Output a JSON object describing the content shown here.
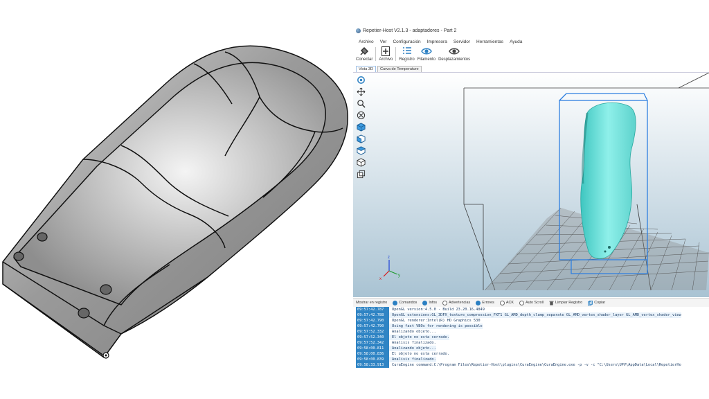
{
  "window": {
    "title": "Repetier-Host V2.1.3 - adaptadores - Part 2"
  },
  "menu": [
    "Archivo",
    "Ver",
    "Configuración",
    "Impresora",
    "Servidor",
    "Herramientas",
    "Ayuda"
  ],
  "toolbar": {
    "connect": "Conectar",
    "file": "Archivo",
    "log": "Registro",
    "filament": "Filamento",
    "travel": "Desplazamientos"
  },
  "tabs": [
    "Vista 3D",
    "Curva de Temperature"
  ],
  "side_tools": [
    "rotate-icon",
    "move-icon",
    "zoom-icon",
    "fit-icon",
    "iso-view-icon",
    "front-view-icon",
    "top-view-icon",
    "side-view-icon"
  ],
  "log_bar": {
    "label": "Mostrar en registro",
    "options": [
      {
        "label": "Comandos",
        "on": true
      },
      {
        "label": "Infos",
        "on": true
      },
      {
        "label": "Advertencias",
        "on": false
      },
      {
        "label": "Errores",
        "on": true
      },
      {
        "label": "ACK",
        "on": false
      },
      {
        "label": "Auto Scroll",
        "on": false
      }
    ],
    "clear": "Limpiar Registro",
    "copy": "Copiar"
  },
  "log": [
    {
      "time": "09:57:42.787",
      "msg": "OpenGL version:4.5.0 - Build 23.20.16.4849"
    },
    {
      "time": "09:57:42.788",
      "msg": "OpenGL extensions:GL_3DFX_texture_compression_FXT1 GL_AMD_depth_clamp_separate GL_AMD_vertex_shader_layer GL_AMD_vertex_shader_view"
    },
    {
      "time": "09:57:42.790",
      "msg": "OpenGL renderer:Intel(R) HD Graphics 530"
    },
    {
      "time": "09:57:42.790",
      "msg": "Using fast VBOs for rendering is possible"
    },
    {
      "time": "09:57:52.332",
      "msg": "Analizando objeto..."
    },
    {
      "time": "09:57:52.340",
      "msg": "El objeto no esta cerrado."
    },
    {
      "time": "09:57:52.342",
      "msg": "Analisis finalizado."
    },
    {
      "time": "09:58:00.811",
      "msg": "Analizando objeto..."
    },
    {
      "time": "09:58:00.836",
      "msg": "El objeto no esta cerrado."
    },
    {
      "time": "09:58:00.839",
      "msg": "Analisis finalizado."
    },
    {
      "time": "09:58:33.913",
      "msg": "CuraEngine command:C:\\Program Files\\Repetier-Host\\plugins\\CuraEngine\\CuraEngine.exe -p -v -c \"C:\\Users\\UPV\\AppData\\Local\\RepetierHo"
    }
  ],
  "colors": {
    "accent": "#2f84c4",
    "model": "#7fe3dc",
    "bbox": "#2e7fe0"
  }
}
